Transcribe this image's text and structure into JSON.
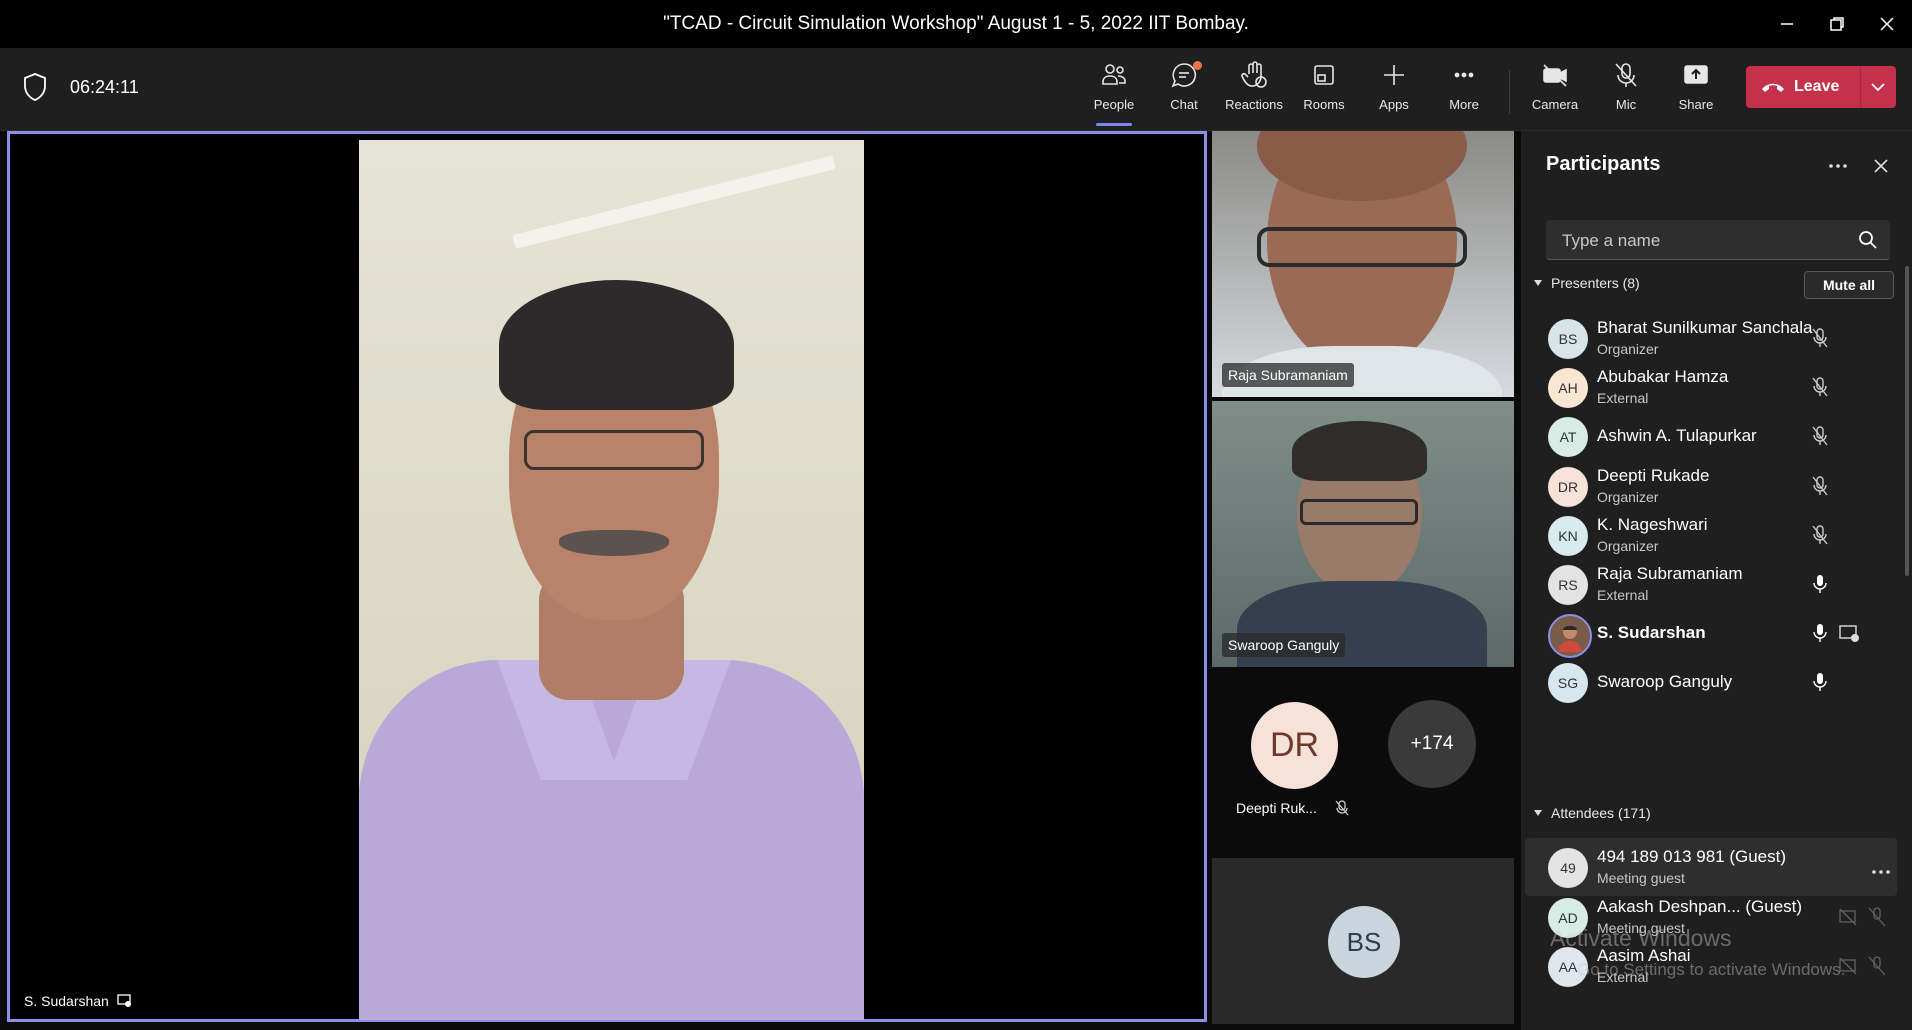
{
  "window": {
    "title": "\"TCAD - Circuit Simulation Workshop\" August 1 - 5, 2022 IIT Bombay."
  },
  "meeting": {
    "timer": "06:24:11"
  },
  "toolbar": {
    "people": "People",
    "chat": "Chat",
    "reactions": "Reactions",
    "rooms": "Rooms",
    "apps": "Apps",
    "more": "More",
    "camera": "Camera",
    "mic": "Mic",
    "share": "Share",
    "leave": "Leave"
  },
  "stage": {
    "main_speaker": "S. Sudarshan",
    "tiles": [
      {
        "name": "Raja Subramaniam"
      },
      {
        "name": "Swaroop Ganguly"
      }
    ],
    "avatar_tile": {
      "initials": "DR",
      "name": "Deepti Ruk..."
    },
    "overflow": "+174",
    "bottom_tile": {
      "initials": "BS"
    }
  },
  "panel": {
    "title": "Participants",
    "search_placeholder": "Type a name",
    "presenters_label": "Presenters (8)",
    "mute_all": "Mute all",
    "attendees_label": "Attendees (171)",
    "presenters": [
      {
        "initials": "BS",
        "name": "Bharat Sunilkumar Sanchala",
        "role": "Organizer",
        "mic": "muted",
        "color": "#d9e3ea"
      },
      {
        "initials": "AH",
        "name": "Abubakar Hamza",
        "role": "External",
        "mic": "muted",
        "color": "#fbe6d4"
      },
      {
        "initials": "AT",
        "name": "Ashwin A. Tulapurkar",
        "role": "",
        "mic": "muted",
        "color": "#d6ece4"
      },
      {
        "initials": "DR",
        "name": "Deepti Rukade",
        "role": "Organizer",
        "mic": "muted",
        "color": "#f6e2d9"
      },
      {
        "initials": "KN",
        "name": "K. Nageshwari",
        "role": "Organizer",
        "mic": "muted",
        "color": "#d8ebef"
      },
      {
        "initials": "RS",
        "name": "Raja Subramaniam",
        "role": "External",
        "mic": "on",
        "color": "#e3e3e3"
      },
      {
        "initials": "",
        "name": "S. Sudarshan",
        "role": "",
        "mic": "on",
        "color": "#7a5a48"
      },
      {
        "initials": "SG",
        "name": "Swaroop Ganguly",
        "role": "",
        "mic": "on",
        "color": "#d6e8ee"
      }
    ],
    "attendees": [
      {
        "initials": "49",
        "name": "494 189 013 981 (Guest)",
        "role": "Meeting guest",
        "color": "#e3e3e3"
      },
      {
        "initials": "AD",
        "name": "Aakash Deshpan... (Guest)",
        "role": "Meeting guest",
        "color": "#d6ece4"
      },
      {
        "initials": "AA",
        "name": "Aasim Ashai",
        "role": "External",
        "color": "#dfe6ee"
      }
    ]
  },
  "watermark": {
    "line1": "Activate Windows",
    "line2": "Go to Settings to activate Windows."
  },
  "colors": {
    "accent": "#7f85f5",
    "leave": "#c4314b",
    "panel": "#1f1f1f"
  }
}
